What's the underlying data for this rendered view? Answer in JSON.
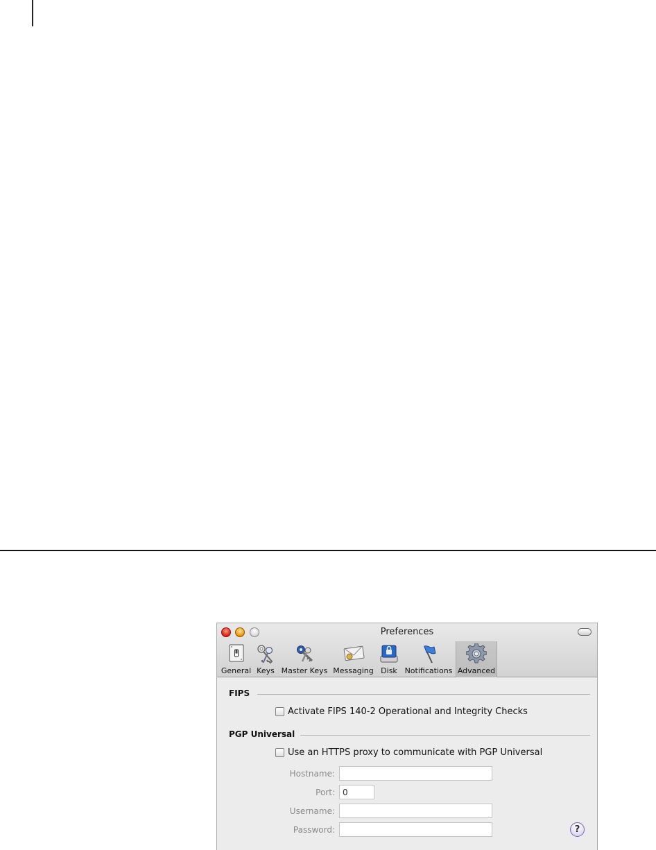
{
  "window": {
    "title": "Preferences"
  },
  "toolbar": {
    "items": [
      {
        "label": "General",
        "icon": "light-switch-icon",
        "selected": false
      },
      {
        "label": "Keys",
        "icon": "keys-icon",
        "selected": false
      },
      {
        "label": "Master Keys",
        "icon": "master-keys-icon",
        "selected": false
      },
      {
        "label": "Messaging",
        "icon": "envelope-icon",
        "selected": false
      },
      {
        "label": "Disk",
        "icon": "locked-disk-icon",
        "selected": false
      },
      {
        "label": "Notifications",
        "icon": "flag-icon",
        "selected": false
      },
      {
        "label": "Advanced",
        "icon": "gear-icon",
        "selected": true
      }
    ]
  },
  "fips": {
    "heading": "FIPS",
    "checkbox_label": "Activate FIPS 140-2 Operational and Integrity Checks",
    "checked": false
  },
  "pgp_universal": {
    "heading": "PGP Universal",
    "checkbox_label": "Use an HTTPS proxy to communicate with PGP Universal",
    "checked": false,
    "hostname_label": "Hostname:",
    "hostname_value": "",
    "port_label": "Port:",
    "port_value": "0",
    "username_label": "Username:",
    "username_value": "",
    "password_label": "Password:",
    "password_value": ""
  },
  "help": {
    "symbol": "?"
  },
  "colors": {
    "window_bg": "#ececec",
    "selected_tab": "#c2c2c2",
    "close": "#e5321f",
    "minimize": "#f3a51a"
  }
}
